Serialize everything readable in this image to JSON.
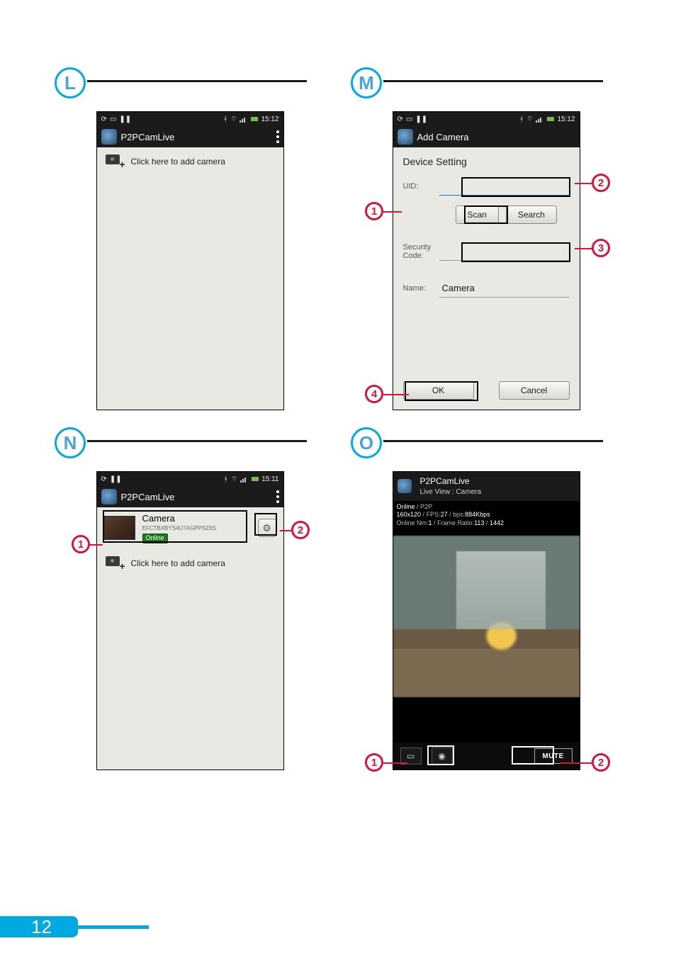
{
  "page_number": "12",
  "panels": {
    "L": {
      "marker": "L",
      "status_time": "15:12",
      "title": "P2PCamLive",
      "add_camera_text": "Click here to add camera"
    },
    "M": {
      "marker": "M",
      "status_time": "15:12",
      "title": "Add Camera",
      "section_title": "Device Setting",
      "uid_label": "UID:",
      "scan_label": "Scan",
      "search_label": "Search",
      "security_label": "Security Code:",
      "name_label": "Name:",
      "name_value": "Camera",
      "ok_label": "OK",
      "cancel_label": "Cancel",
      "callouts": {
        "c1": "1",
        "c2": "2",
        "c3": "3",
        "c4": "4"
      }
    },
    "N": {
      "marker": "N",
      "status_time": "15:11",
      "title": "P2PCamLive",
      "camera_name": "Camera",
      "camera_uid": "EFCTBXBYS4U7AGPPSZ6S",
      "camera_status": "Online",
      "add_camera_text": "Click here to add camera",
      "callouts": {
        "c1": "1",
        "c2": "2"
      }
    },
    "O": {
      "marker": "O",
      "app_title": "P2PCamLive",
      "subtitle": "Live View : Camera",
      "info_line1_a": "Online",
      "info_line1_b": "P2P",
      "info_line2_res": "160x120",
      "info_line2_fps_lbl": "FPS:",
      "info_line2_fps": "27",
      "info_line2_bps_lbl": "bps:",
      "info_line2_bps": "884Kbps",
      "info_line3_a_lbl": "Online Nm:",
      "info_line3_a": "1",
      "info_line3_b_lbl": "Frame Ratio:",
      "info_line3_b1": "113",
      "info_line3_b2": "1442",
      "mute_label": "MUTE",
      "callouts": {
        "c1": "1",
        "c2": "2"
      }
    }
  }
}
